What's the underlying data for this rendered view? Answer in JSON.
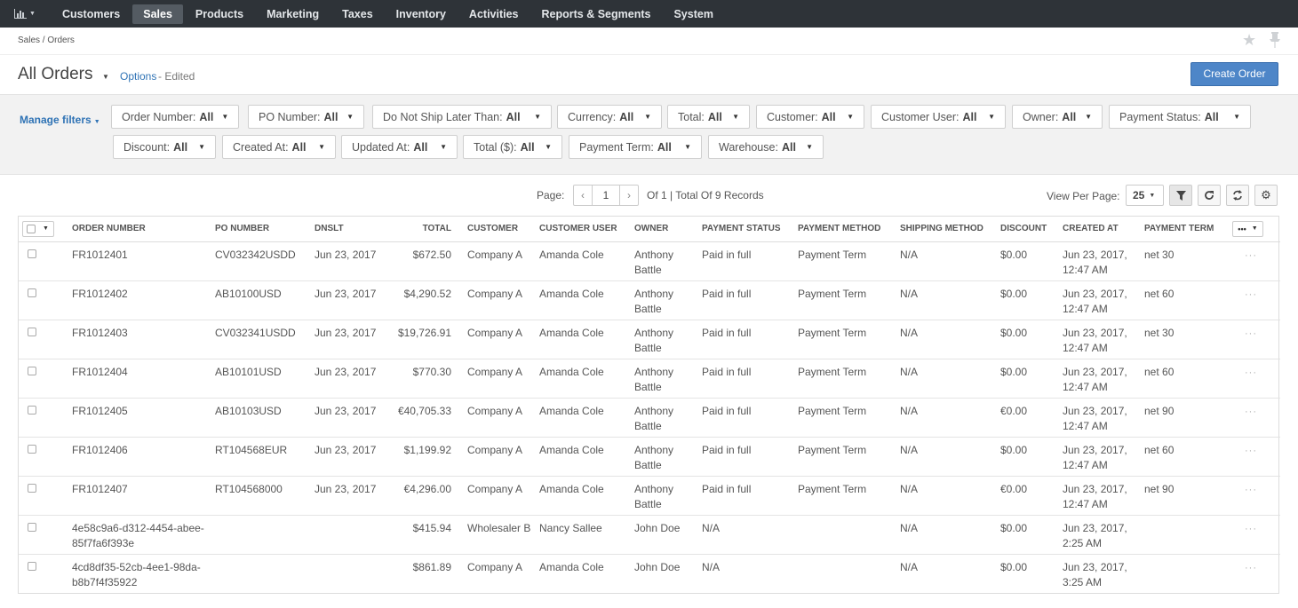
{
  "nav": {
    "dashboard_icon": "bar-chart-icon",
    "items": [
      {
        "label": "Customers",
        "active": false
      },
      {
        "label": "Sales",
        "active": true
      },
      {
        "label": "Products",
        "active": false
      },
      {
        "label": "Marketing",
        "active": false
      },
      {
        "label": "Taxes",
        "active": false
      },
      {
        "label": "Inventory",
        "active": false
      },
      {
        "label": "Activities",
        "active": false
      },
      {
        "label": "Reports & Segments",
        "active": false
      },
      {
        "label": "System",
        "active": false
      }
    ]
  },
  "breadcrumb": "Sales / Orders",
  "page": {
    "title": "All Orders",
    "options_label": "Options",
    "edited_label": "- Edited",
    "create_button": "Create Order"
  },
  "filters": {
    "manage_label": "Manage filters",
    "items": [
      {
        "label": "Order Number:",
        "value": "All"
      },
      {
        "label": "PO Number:",
        "value": "All"
      },
      {
        "label": "Do Not Ship Later Than:",
        "value": "All"
      },
      {
        "label": "Currency:",
        "value": "All"
      },
      {
        "label": "Total:",
        "value": "All"
      },
      {
        "label": "Customer:",
        "value": "All"
      },
      {
        "label": "Customer User:",
        "value": "All"
      },
      {
        "label": "Owner:",
        "value": "All"
      },
      {
        "label": "Payment Status:",
        "value": "All"
      },
      {
        "label": "Discount:",
        "value": "All"
      },
      {
        "label": "Created At:",
        "value": "All"
      },
      {
        "label": "Updated At:",
        "value": "All"
      },
      {
        "label": "Total ($):",
        "value": "All"
      },
      {
        "label": "Payment Term:",
        "value": "All"
      },
      {
        "label": "Warehouse:",
        "value": "All"
      }
    ]
  },
  "pagination": {
    "page_label": "Page:",
    "current_page": "1",
    "records_text": "Of 1 | Total Of 9 Records",
    "view_per_page_label": "View Per Page:",
    "per_page": "25"
  },
  "grid": {
    "columns": [
      "Order Number",
      "PO Number",
      "DNSLT",
      "Total",
      "Customer",
      "Customer User",
      "Owner",
      "Payment Status",
      "Payment Method",
      "Shipping Method",
      "Discount",
      "Created At",
      "Payment Term"
    ],
    "column_menu": "•••",
    "row_action": "···",
    "rows": [
      {
        "order": "FR1012401",
        "po": "CV032342USDD",
        "dnslt": "Jun 23, 2017",
        "total": "$672.50",
        "customer": "Company A",
        "customer_user": "Amanda Cole",
        "owner": "Anthony Battle",
        "payment_status": "Paid in full",
        "payment_method": "Payment Term",
        "shipping_method": "N/A",
        "discount": "$0.00",
        "created_at": "Jun 23, 2017, 12:47 AM",
        "payment_term": "net 30"
      },
      {
        "order": "FR1012402",
        "po": "AB10100USD",
        "dnslt": "Jun 23, 2017",
        "total": "$4,290.52",
        "customer": "Company A",
        "customer_user": "Amanda Cole",
        "owner": "Anthony Battle",
        "payment_status": "Paid in full",
        "payment_method": "Payment Term",
        "shipping_method": "N/A",
        "discount": "$0.00",
        "created_at": "Jun 23, 2017, 12:47 AM",
        "payment_term": "net 60"
      },
      {
        "order": "FR1012403",
        "po": "CV032341USDD",
        "dnslt": "Jun 23, 2017",
        "total": "$19,726.91",
        "customer": "Company A",
        "customer_user": "Amanda Cole",
        "owner": "Anthony Battle",
        "payment_status": "Paid in full",
        "payment_method": "Payment Term",
        "shipping_method": "N/A",
        "discount": "$0.00",
        "created_at": "Jun 23, 2017, 12:47 AM",
        "payment_term": "net 30"
      },
      {
        "order": "FR1012404",
        "po": "AB10101USD",
        "dnslt": "Jun 23, 2017",
        "total": "$770.30",
        "customer": "Company A",
        "customer_user": "Amanda Cole",
        "owner": "Anthony Battle",
        "payment_status": "Paid in full",
        "payment_method": "Payment Term",
        "shipping_method": "N/A",
        "discount": "$0.00",
        "created_at": "Jun 23, 2017, 12:47 AM",
        "payment_term": "net 60"
      },
      {
        "order": "FR1012405",
        "po": "AB10103USD",
        "dnslt": "Jun 23, 2017",
        "total": "€40,705.33",
        "customer": "Company A",
        "customer_user": "Amanda Cole",
        "owner": "Anthony Battle",
        "payment_status": "Paid in full",
        "payment_method": "Payment Term",
        "shipping_method": "N/A",
        "discount": "€0.00",
        "created_at": "Jun 23, 2017, 12:47 AM",
        "payment_term": "net 90"
      },
      {
        "order": "FR1012406",
        "po": "RT104568EUR",
        "dnslt": "Jun 23, 2017",
        "total": "$1,199.92",
        "customer": "Company A",
        "customer_user": "Amanda Cole",
        "owner": "Anthony Battle",
        "payment_status": "Paid in full",
        "payment_method": "Payment Term",
        "shipping_method": "N/A",
        "discount": "$0.00",
        "created_at": "Jun 23, 2017, 12:47 AM",
        "payment_term": "net 60"
      },
      {
        "order": "FR1012407",
        "po": "RT104568000",
        "dnslt": "Jun 23, 2017",
        "total": "€4,296.00",
        "customer": "Company A",
        "customer_user": "Amanda Cole",
        "owner": "Anthony Battle",
        "payment_status": "Paid in full",
        "payment_method": "Payment Term",
        "shipping_method": "N/A",
        "discount": "€0.00",
        "created_at": "Jun 23, 2017, 12:47 AM",
        "payment_term": "net 90"
      },
      {
        "order": "4e58c9a6-d312-4454-abee-85f7fa6f393e",
        "po": "",
        "dnslt": "",
        "total": "$415.94",
        "customer": "Wholesaler B",
        "customer_user": "Nancy Sallee",
        "owner": "John Doe",
        "payment_status": "N/A",
        "payment_method": "",
        "shipping_method": "N/A",
        "discount": "$0.00",
        "created_at": "Jun 23, 2017, 2:25 AM",
        "payment_term": ""
      },
      {
        "order": "4cd8df35-52cb-4ee1-98da-b8b7f4f35922",
        "po": "",
        "dnslt": "",
        "total": "$861.89",
        "customer": "Company A",
        "customer_user": "Amanda Cole",
        "owner": "John Doe",
        "payment_status": "N/A",
        "payment_method": "",
        "shipping_method": "N/A",
        "discount": "$0.00",
        "created_at": "Jun 23, 2017, 3:25 AM",
        "payment_term": ""
      }
    ]
  }
}
